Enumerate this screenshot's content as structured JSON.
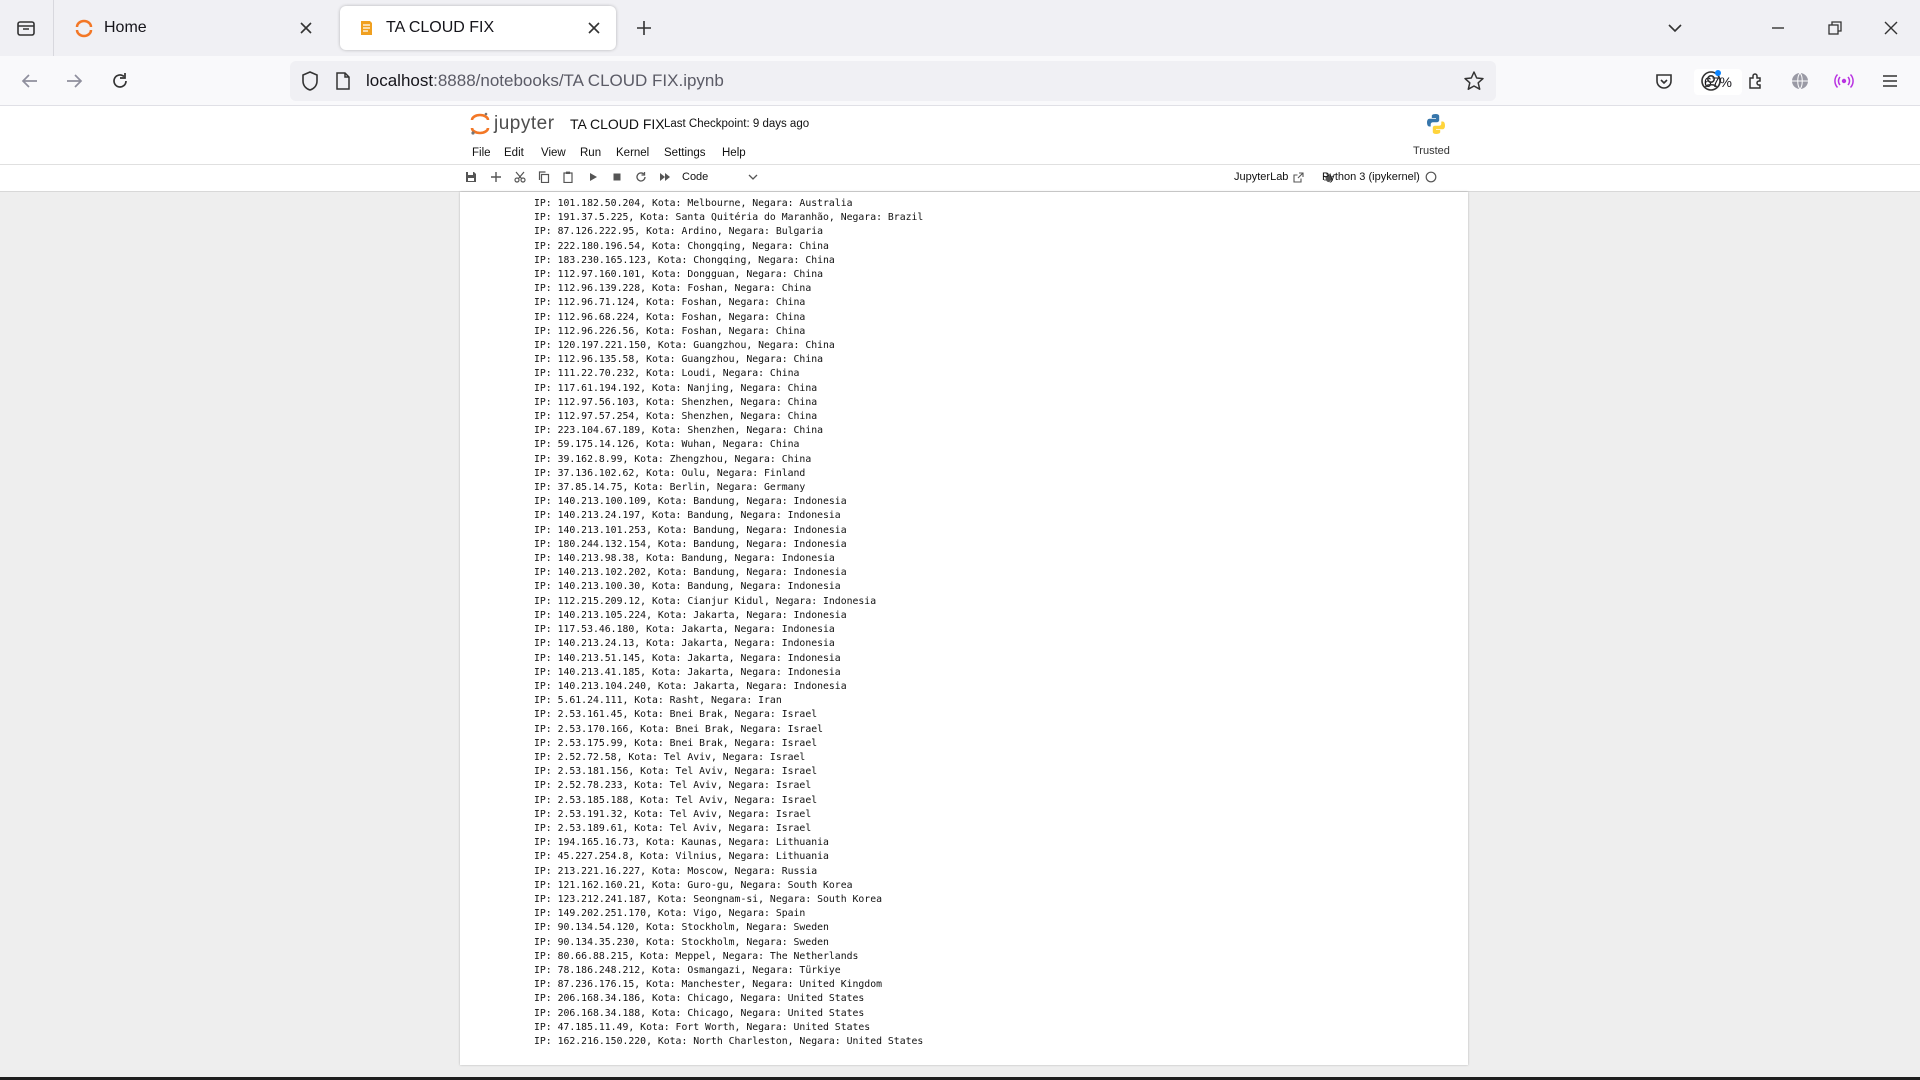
{
  "browser": {
    "tabs": [
      {
        "title": "Home",
        "active": false,
        "icon": "jupyter-home-icon"
      },
      {
        "title": "TA CLOUD FIX",
        "active": true,
        "icon": "notebook-icon"
      }
    ],
    "url": {
      "host": "localhost",
      "path": ":8888/notebooks/TA CLOUD FIX.ipynb"
    },
    "zoom": "67%"
  },
  "jupyter": {
    "logo_text": "jupyter",
    "notebook_title": "TA CLOUD FIX",
    "checkpoint": "Last Checkpoint: 9 days ago",
    "menus": [
      "File",
      "Edit",
      "View",
      "Run",
      "Kernel",
      "Settings",
      "Help"
    ],
    "trusted": "Trusted",
    "cell_type": "Code",
    "jupyterlab_link": "JupyterLab",
    "kernel_name": "Python 3 (ipykernel)"
  },
  "output_lines": [
    "IP: 101.182.50.204, Kota: Melbourne, Negara: Australia",
    "IP: 191.37.5.225, Kota: Santa Quitéria do Maranhão, Negara: Brazil",
    "IP: 87.126.222.95, Kota: Ardino, Negara: Bulgaria",
    "IP: 222.180.196.54, Kota: Chongqing, Negara: China",
    "IP: 183.230.165.123, Kota: Chongqing, Negara: China",
    "IP: 112.97.160.101, Kota: Dongguan, Negara: China",
    "IP: 112.96.139.228, Kota: Foshan, Negara: China",
    "IP: 112.96.71.124, Kota: Foshan, Negara: China",
    "IP: 112.96.68.224, Kota: Foshan, Negara: China",
    "IP: 112.96.226.56, Kota: Foshan, Negara: China",
    "IP: 120.197.221.150, Kota: Guangzhou, Negara: China",
    "IP: 112.96.135.58, Kota: Guangzhou, Negara: China",
    "IP: 111.22.70.232, Kota: Loudi, Negara: China",
    "IP: 117.61.194.192, Kota: Nanjing, Negara: China",
    "IP: 112.97.56.103, Kota: Shenzhen, Negara: China",
    "IP: 112.97.57.254, Kota: Shenzhen, Negara: China",
    "IP: 223.104.67.189, Kota: Shenzhen, Negara: China",
    "IP: 59.175.14.126, Kota: Wuhan, Negara: China",
    "IP: 39.162.8.99, Kota: Zhengzhou, Negara: China",
    "IP: 37.136.102.62, Kota: Oulu, Negara: Finland",
    "IP: 37.85.14.75, Kota: Berlin, Negara: Germany",
    "IP: 140.213.100.109, Kota: Bandung, Negara: Indonesia",
    "IP: 140.213.24.197, Kota: Bandung, Negara: Indonesia",
    "IP: 140.213.101.253, Kota: Bandung, Negara: Indonesia",
    "IP: 180.244.132.154, Kota: Bandung, Negara: Indonesia",
    "IP: 140.213.98.38, Kota: Bandung, Negara: Indonesia",
    "IP: 140.213.102.202, Kota: Bandung, Negara: Indonesia",
    "IP: 140.213.100.30, Kota: Bandung, Negara: Indonesia",
    "IP: 112.215.209.12, Kota: Cianjur Kidul, Negara: Indonesia",
    "IP: 140.213.105.224, Kota: Jakarta, Negara: Indonesia",
    "IP: 117.53.46.180, Kota: Jakarta, Negara: Indonesia",
    "IP: 140.213.24.13, Kota: Jakarta, Negara: Indonesia",
    "IP: 140.213.51.145, Kota: Jakarta, Negara: Indonesia",
    "IP: 140.213.41.185, Kota: Jakarta, Negara: Indonesia",
    "IP: 140.213.104.240, Kota: Jakarta, Negara: Indonesia",
    "IP: 5.61.24.111, Kota: Rasht, Negara: Iran",
    "IP: 2.53.161.45, Kota: Bnei Brak, Negara: Israel",
    "IP: 2.53.170.166, Kota: Bnei Brak, Negara: Israel",
    "IP: 2.53.175.99, Kota: Bnei Brak, Negara: Israel",
    "IP: 2.52.72.58, Kota: Tel Aviv, Negara: Israel",
    "IP: 2.53.181.156, Kota: Tel Aviv, Negara: Israel",
    "IP: 2.52.78.233, Kota: Tel Aviv, Negara: Israel",
    "IP: 2.53.185.188, Kota: Tel Aviv, Negara: Israel",
    "IP: 2.53.191.32, Kota: Tel Aviv, Negara: Israel",
    "IP: 2.53.189.61, Kota: Tel Aviv, Negara: Israel",
    "IP: 194.165.16.73, Kota: Kaunas, Negara: Lithuania",
    "IP: 45.227.254.8, Kota: Vilnius, Negara: Lithuania",
    "IP: 213.221.16.227, Kota: Moscow, Negara: Russia",
    "IP: 121.162.160.21, Kota: Guro-gu, Negara: South Korea",
    "IP: 123.212.241.187, Kota: Seongnam-si, Negara: South Korea",
    "IP: 149.202.251.170, Kota: Vigo, Negara: Spain",
    "IP: 90.134.54.120, Kota: Stockholm, Negara: Sweden",
    "IP: 90.134.35.230, Kota: Stockholm, Negara: Sweden",
    "IP: 80.66.88.215, Kota: Meppel, Negara: The Netherlands",
    "IP: 78.186.248.212, Kota: Osmangazi, Negara: Türkiye",
    "IP: 87.236.176.15, Kota: Manchester, Negara: United Kingdom",
    "IP: 206.168.34.186, Kota: Chicago, Negara: United States",
    "IP: 206.168.34.188, Kota: Chicago, Negara: United States",
    "IP: 47.185.11.49, Kota: Fort Worth, Negara: United States",
    "IP: 162.216.150.220, Kota: North Charleston, Negara: United States"
  ]
}
